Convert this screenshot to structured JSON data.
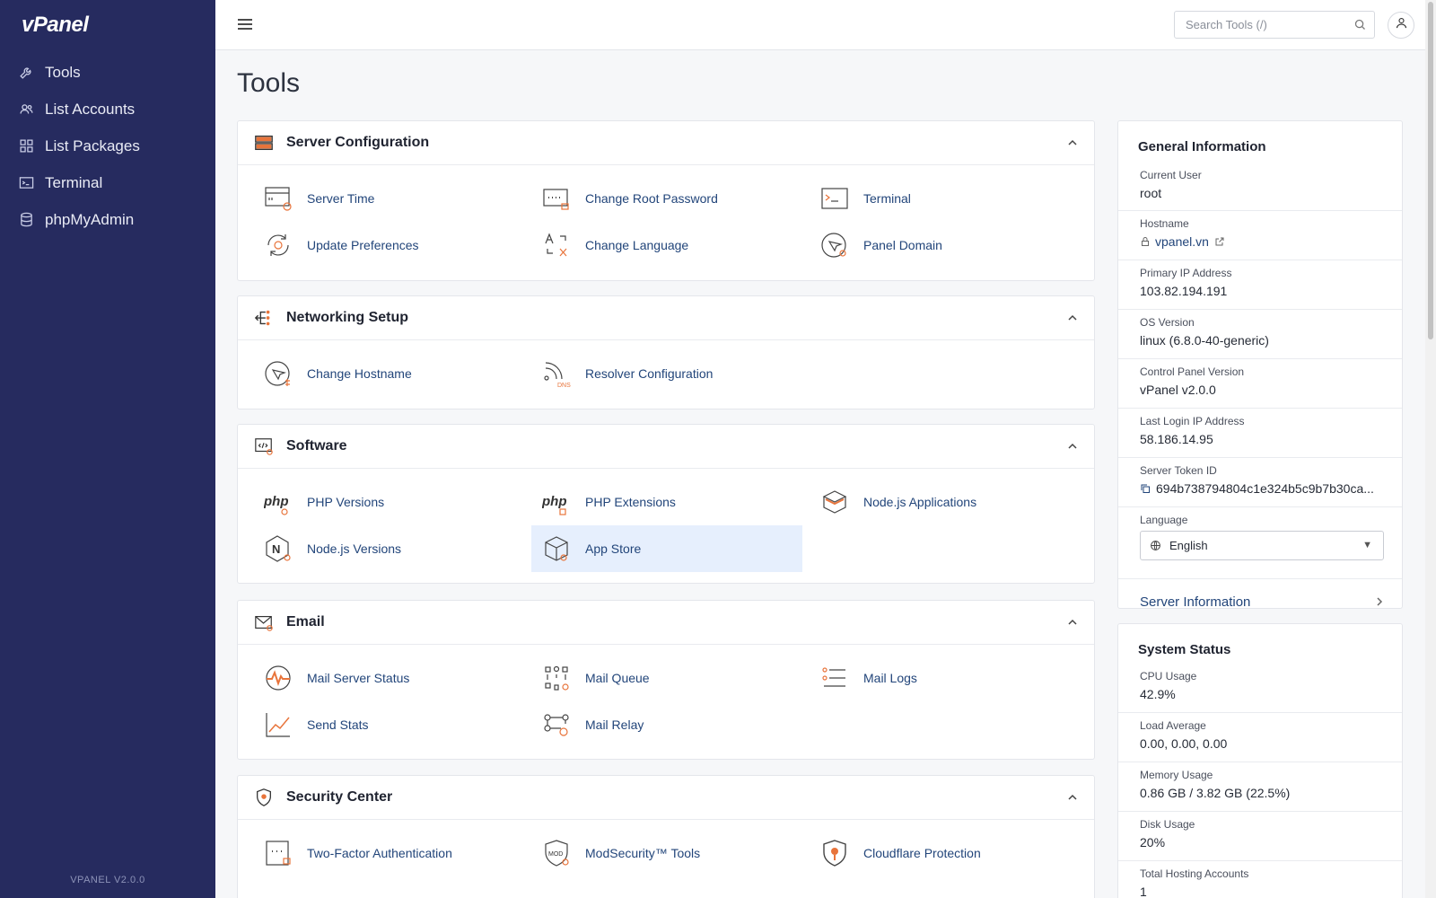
{
  "app": {
    "logo": "vPanel",
    "version_label": "VPANEL V2.0.0"
  },
  "sidebar": {
    "items": [
      {
        "label": "Tools",
        "icon": "wrench-icon"
      },
      {
        "label": "List Accounts",
        "icon": "users-icon"
      },
      {
        "label": "List Packages",
        "icon": "grid-icon"
      },
      {
        "label": "Terminal",
        "icon": "terminal-icon"
      },
      {
        "label": "phpMyAdmin",
        "icon": "database-icon"
      }
    ]
  },
  "header": {
    "search_placeholder": "Search Tools (/)"
  },
  "page": {
    "title": "Tools"
  },
  "sections": {
    "server_configuration": {
      "title": "Server Configuration",
      "tools": [
        "Server Time",
        "Change Root Password",
        "Terminal",
        "Update Preferences",
        "Change Language",
        "Panel Domain"
      ]
    },
    "networking_setup": {
      "title": "Networking Setup",
      "tools": [
        "Change Hostname",
        "Resolver Configuration"
      ]
    },
    "software": {
      "title": "Software",
      "tools": [
        "PHP Versions",
        "PHP Extensions",
        "Node.js Applications",
        "Node.js Versions",
        "App Store"
      ]
    },
    "email": {
      "title": "Email",
      "tools": [
        "Mail Server Status",
        "Mail Queue",
        "Mail Logs",
        "Send Stats",
        "Mail Relay"
      ]
    },
    "security_center": {
      "title": "Security Center",
      "tools": [
        "Two-Factor Authentication",
        "ModSecurity™ Tools",
        "Cloudflare Protection"
      ]
    }
  },
  "general_info": {
    "title": "General Information",
    "current_user": {
      "label": "Current User",
      "value": "root"
    },
    "hostname": {
      "label": "Hostname",
      "value": "vpanel.vn"
    },
    "primary_ip": {
      "label": "Primary IP Address",
      "value": "103.82.194.191"
    },
    "os_version": {
      "label": "OS Version",
      "value": "linux (6.8.0-40-generic)"
    },
    "panel_version": {
      "label": "Control Panel Version",
      "value": "vPanel v2.0.0"
    },
    "last_login_ip": {
      "label": "Last Login IP Address",
      "value": "58.186.14.95"
    },
    "server_token": {
      "label": "Server Token ID",
      "value": "694b738794804c1e324b5c9b7b30ca..."
    },
    "language": {
      "label": "Language",
      "value": "English"
    },
    "server_info_link": "Server Information"
  },
  "system_status": {
    "title": "System Status",
    "cpu": {
      "label": "CPU Usage",
      "value": "42.9%"
    },
    "load": {
      "label": "Load Average",
      "value": "0.00, 0.00, 0.00"
    },
    "memory": {
      "label": "Memory Usage",
      "value": "0.86 GB / 3.82 GB (22.5%)"
    },
    "disk": {
      "label": "Disk Usage",
      "value": "20%"
    },
    "accounts": {
      "label": "Total Hosting Accounts",
      "value": "1"
    }
  },
  "colors": {
    "sidebar_bg": "#262b5f",
    "link": "#22457a",
    "accent": "#e8743b",
    "highlight": "#e6effd"
  }
}
